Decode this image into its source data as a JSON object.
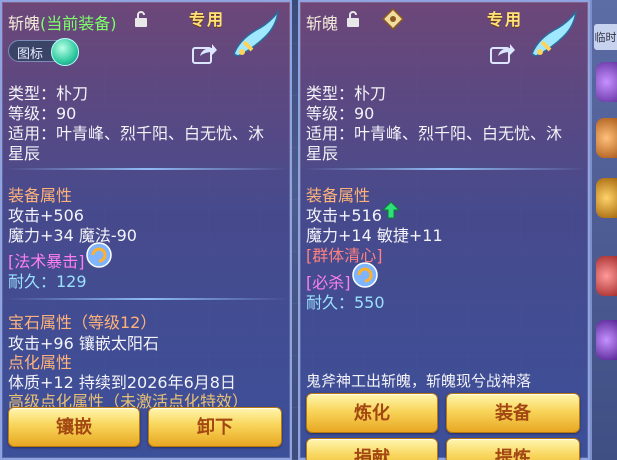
{
  "left": {
    "name_prefix": "斩魄",
    "name_suffix": "(当前装备)",
    "exclusive": "专用",
    "toggle_label": "图标",
    "type": "类型：朴刀",
    "level": "等级：90",
    "applies": "适用：叶青峰、烈千阳、白无忧、沐",
    "applies2": "星辰",
    "attr_header": "装备属性",
    "attack": "攻击+506",
    "magic": "魔力+34 魔法-90",
    "skill": "[法术暴击]",
    "durability": "耐久：129",
    "gem_header": "宝石属性（等级12）",
    "gem_line": "攻击+96 镶嵌太阳石",
    "refine_header": "点化属性",
    "refine_line": "体质+12 持续到2026年6月8日",
    "advanced": "高级点化属性（未激活点化特效）",
    "btn_inlay": "镶嵌",
    "btn_unequip": "卸下"
  },
  "right": {
    "name": "斩魄",
    "exclusive": "专用",
    "type": "类型：朴刀",
    "level": "等级：90",
    "applies": "适用：叶青峰、烈千阳、白无忧、沐",
    "applies2": "星辰",
    "attr_header": "装备属性",
    "attack": "攻击+516",
    "stats": "魔力+14 敏捷+11",
    "skill1": "[群体清心]",
    "skill2": "[必杀]",
    "durability": "耐久：550",
    "desc": "鬼斧神工出斩魄，斩魄现兮战神落",
    "btn_refine": "炼化",
    "btn_equip": "装备",
    "btn_donate": "捐献",
    "btn_extract": "提炼"
  },
  "strip": {
    "tab": "临时"
  },
  "colors": {
    "green_name": "#7dff6a",
    "header_orange": "#ffb37a",
    "skill_pink": "#ff7ff0",
    "skill_red": "#ff8080",
    "durability_blue": "#9ae0ff",
    "button_gold": "#f8d55a"
  }
}
